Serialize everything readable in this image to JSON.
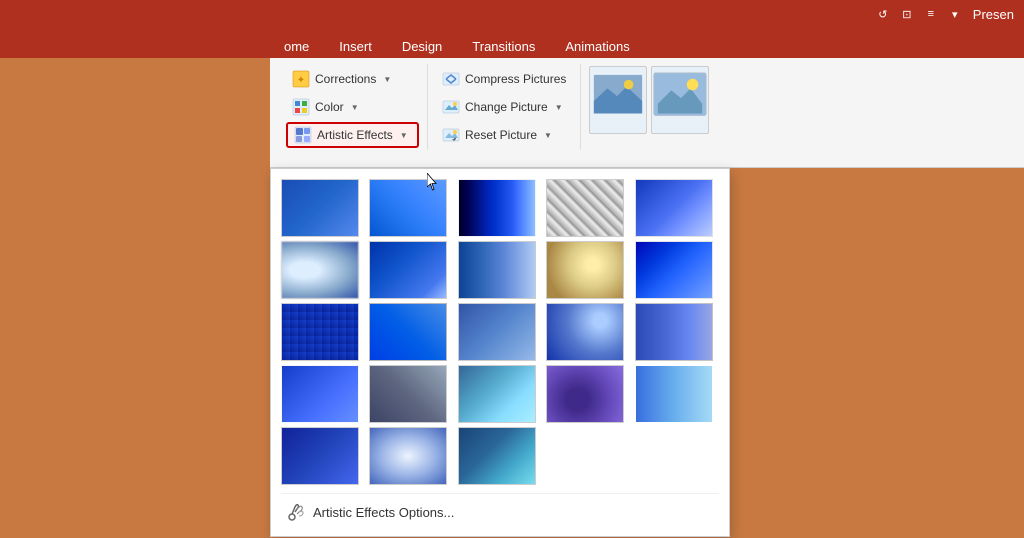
{
  "titleBar": {
    "title": "Presen",
    "icons": [
      "undo-icon",
      "save-icon",
      "format-icon",
      "quick-access-icon"
    ]
  },
  "ribbonTabs": {
    "tabs": [
      {
        "label": "ome",
        "active": false
      },
      {
        "label": "Insert",
        "active": false
      },
      {
        "label": "Design",
        "active": false
      },
      {
        "label": "Transitions",
        "active": false
      },
      {
        "label": "Animations",
        "active": false
      }
    ]
  },
  "adjustGroup": {
    "corrections": {
      "label": "Corrections",
      "arrow": "▼"
    },
    "color": {
      "label": "Color",
      "arrow": "▼"
    },
    "artisticEffects": {
      "label": "Artistic Effects",
      "arrow": "▼"
    }
  },
  "pictureGroup": {
    "compress": {
      "label": "Compress Pictures"
    },
    "changePicture": {
      "label": "Change Picture",
      "arrow": "▼"
    },
    "resetPicture": {
      "label": "Reset Picture",
      "arrow": "▼"
    }
  },
  "dropdown": {
    "effects": [
      {
        "id": 1,
        "class": "effect-1"
      },
      {
        "id": 2,
        "class": "effect-2"
      },
      {
        "id": 3,
        "class": "effect-3"
      },
      {
        "id": 4,
        "class": "effect-4"
      },
      {
        "id": 5,
        "class": "effect-5"
      },
      {
        "id": 6,
        "class": "effect-6"
      },
      {
        "id": 7,
        "class": "effect-7"
      },
      {
        "id": 8,
        "class": "effect-8"
      },
      {
        "id": 9,
        "class": "effect-9"
      },
      {
        "id": 10,
        "class": "effect-10"
      },
      {
        "id": 11,
        "class": "effect-11"
      },
      {
        "id": 12,
        "class": "effect-12"
      },
      {
        "id": 13,
        "class": "effect-13"
      },
      {
        "id": 14,
        "class": "effect-14"
      },
      {
        "id": 15,
        "class": "effect-15"
      },
      {
        "id": 16,
        "class": "effect-16"
      },
      {
        "id": 17,
        "class": "effect-17"
      },
      {
        "id": 18,
        "class": "effect-18"
      },
      {
        "id": 19,
        "class": "effect-19"
      },
      {
        "id": 20,
        "class": "effect-20"
      },
      {
        "id": 21,
        "class": "effect-21"
      },
      {
        "id": 22,
        "class": "effect-22"
      },
      {
        "id": 23,
        "class": "effect-23"
      }
    ],
    "optionLabel": "Artistic Effects Options..."
  },
  "colors": {
    "titleBarBg": "#B03020",
    "ribbonTabsBg": "#B03020",
    "bodyBg": "#C87941",
    "ribbonBg": "#f5f5f5",
    "highlightBorder": "#cc0000"
  }
}
